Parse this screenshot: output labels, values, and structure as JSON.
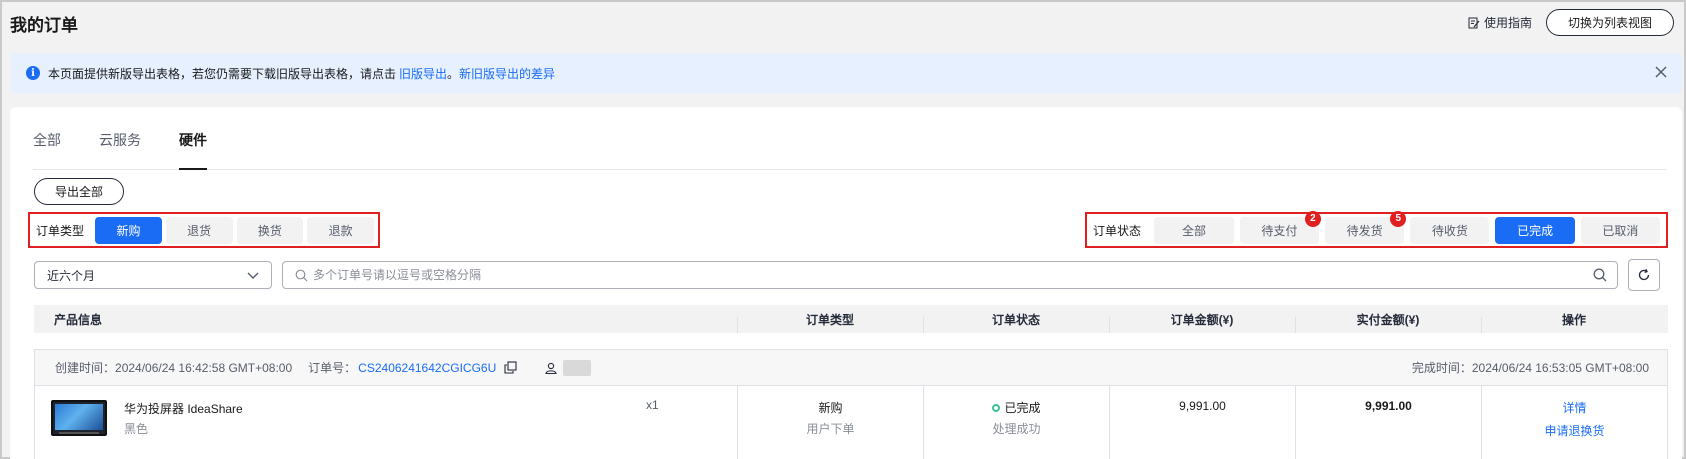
{
  "header": {
    "title": "我的订单",
    "guide_label": "使用指南",
    "switch_view_label": "切换为列表视图"
  },
  "notice": {
    "text": "本页面提供新版导出表格，若您仍需要下载旧版导出表格，请点击",
    "old_export_link": "旧版导出",
    "separator": "。",
    "diff_link": "新旧版导出的差异"
  },
  "tabs": [
    {
      "label": "全部",
      "active": false
    },
    {
      "label": "云服务",
      "active": false
    },
    {
      "label": "硬件",
      "active": true
    }
  ],
  "export_all_label": "导出全部",
  "order_type_filter": {
    "label": "订单类型",
    "options": [
      {
        "label": "新购",
        "active": true
      },
      {
        "label": "退货",
        "active": false
      },
      {
        "label": "换货",
        "active": false
      },
      {
        "label": "退款",
        "active": false
      }
    ]
  },
  "order_status_filter": {
    "label": "订单状态",
    "options": [
      {
        "label": "全部",
        "active": false,
        "badge": ""
      },
      {
        "label": "待支付",
        "active": false,
        "badge": "2"
      },
      {
        "label": "待发货",
        "active": false,
        "badge": "5"
      },
      {
        "label": "待收货",
        "active": false,
        "badge": ""
      },
      {
        "label": "已完成",
        "active": true,
        "badge": ""
      },
      {
        "label": "已取消",
        "active": false,
        "badge": ""
      }
    ]
  },
  "time_range": {
    "value": "近六个月"
  },
  "search": {
    "placeholder": "多个订单号请以逗号或空格分隔",
    "value": ""
  },
  "table": {
    "columns": [
      "产品信息",
      "订单类型",
      "订单状态",
      "订单金额(¥)",
      "实付金额(¥)",
      "操作"
    ]
  },
  "order": {
    "created_label": "创建时间：",
    "created_time": "2024/06/24 16:42:58 GMT+08:00",
    "order_no_label": "订单号：",
    "order_no": "CS2406241642CGICG6U",
    "finished_label": "完成时间：",
    "finished_time": "2024/06/24 16:53:05 GMT+08:00",
    "product_name": "华为投屏器 IdeaShare",
    "product_color": "黑色",
    "quantity": "x1",
    "type": "新购",
    "type_sub": "用户下单",
    "status": "已完成",
    "status_sub": "处理成功",
    "order_amount": "9,991.00",
    "paid_amount": "9,991.00",
    "actions": [
      "详情",
      "申请退换货"
    ]
  },
  "colors": {
    "accent": "#1a6cf5",
    "highlight_border": "#e02020",
    "badge": "#e02020",
    "status_ok": "#3ac295"
  }
}
